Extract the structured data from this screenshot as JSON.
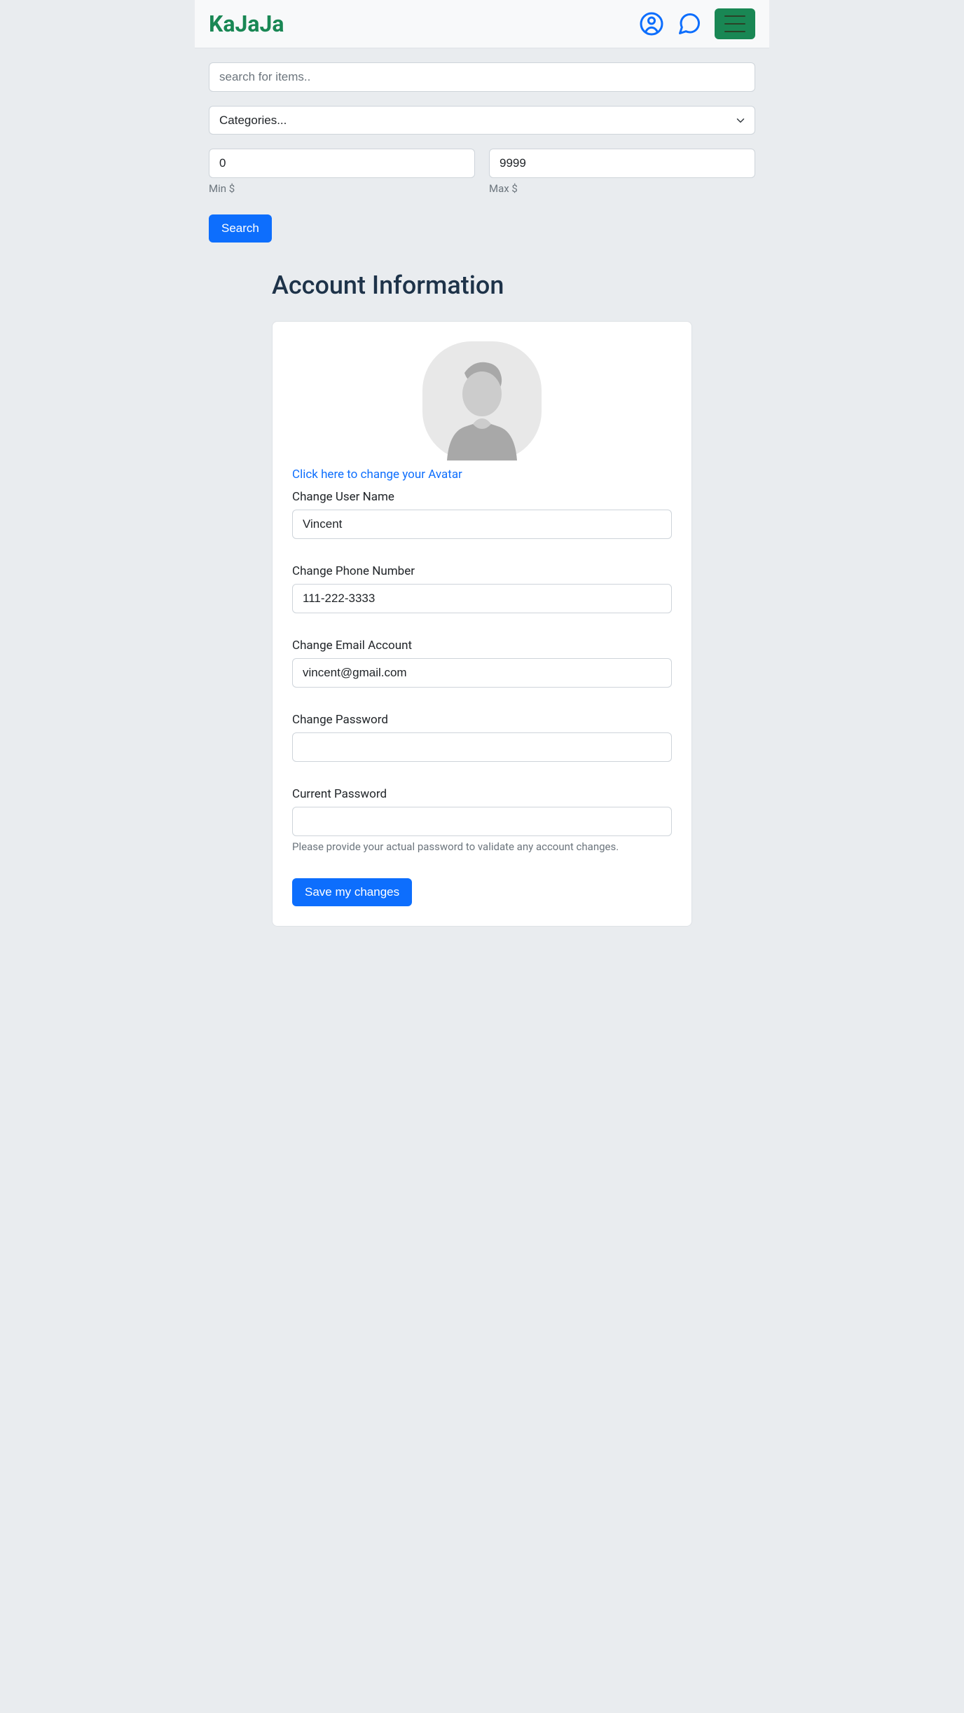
{
  "brand": "KaJaJa",
  "search": {
    "placeholder": "search for items..",
    "categories_label": "Categories...",
    "min_value": "0",
    "max_value": "9999",
    "min_label": "Min $",
    "max_label": "Max $",
    "button_label": "Search"
  },
  "page": {
    "title": "Account Information"
  },
  "account": {
    "avatar_link": "Click here to change your Avatar",
    "username_label": "Change User Name",
    "username_value": "Vincent",
    "phone_label": "Change Phone Number",
    "phone_value": "111-222-3333",
    "email_label": "Change Email Account",
    "email_value": "vincent@gmail.com",
    "password_label": "Change Password",
    "password_value": "",
    "current_password_label": "Current Password",
    "current_password_value": "",
    "current_password_help": "Please provide your actual password to validate any account changes.",
    "save_button": "Save my changes"
  }
}
